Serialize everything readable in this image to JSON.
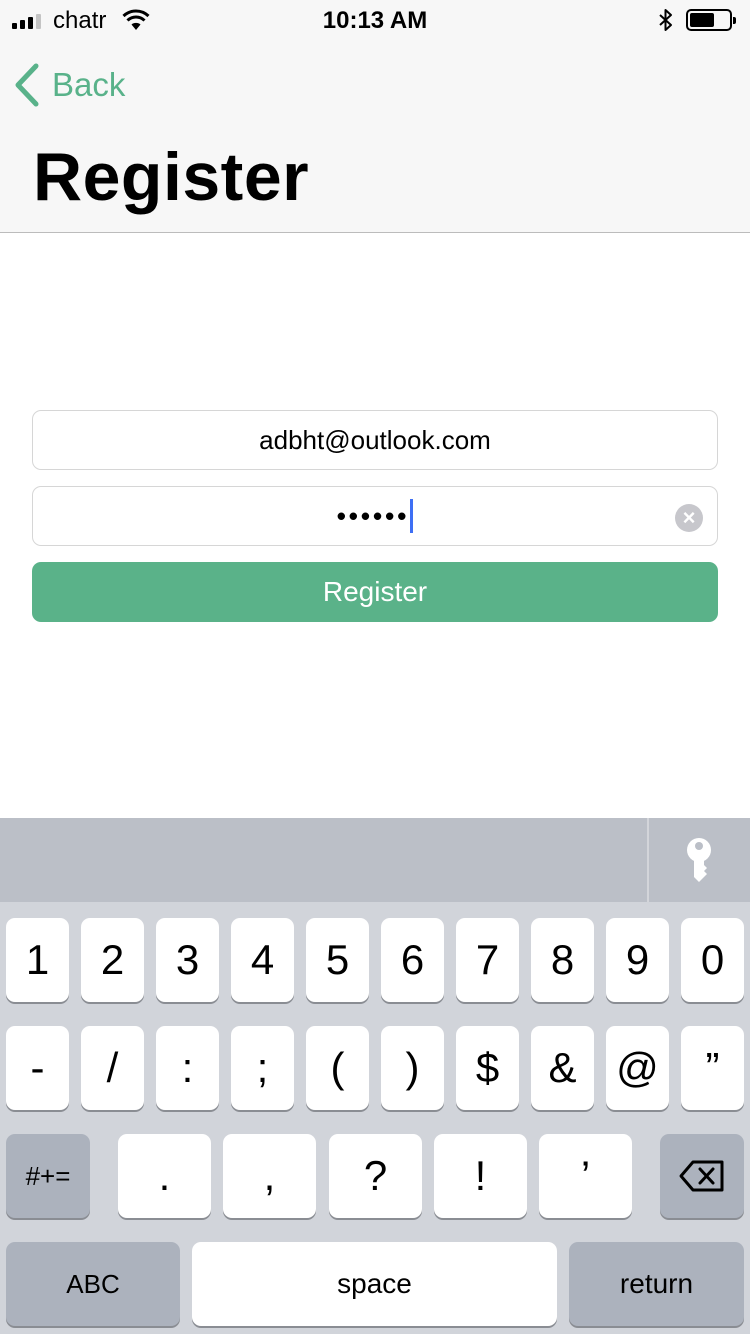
{
  "status_bar": {
    "carrier": "chatr",
    "time": "10:13 AM",
    "signal_bars": 3,
    "battery_level": 0.55,
    "icons": [
      "signal-icon",
      "wifi-icon",
      "bluetooth-icon",
      "battery-icon"
    ]
  },
  "nav": {
    "back_label": "Back",
    "title": "Register"
  },
  "form": {
    "email_value": "adbht@outlook.com",
    "password_value": "••••••",
    "register_label": "Register"
  },
  "keyboard": {
    "toolbar_icon": "key-icon",
    "row1": [
      "1",
      "2",
      "3",
      "4",
      "5",
      "6",
      "7",
      "8",
      "9",
      "0"
    ],
    "row2": [
      "-",
      "/",
      ":",
      ";",
      "(",
      ")",
      "$",
      "&",
      "@",
      "”"
    ],
    "row3_mode": "#+=",
    "row3": [
      ".",
      ",",
      "?",
      "!",
      "’"
    ],
    "delete_icon": "delete-icon",
    "abc_label": "ABC",
    "space_label": "space",
    "return_label": "return"
  },
  "colors": {
    "accent": "#59b28a",
    "button": "#5ab289",
    "cursor": "#3e6ff4",
    "keyboard_bg": "#d1d4da",
    "toolbar_bg": "#bbbfc7"
  }
}
